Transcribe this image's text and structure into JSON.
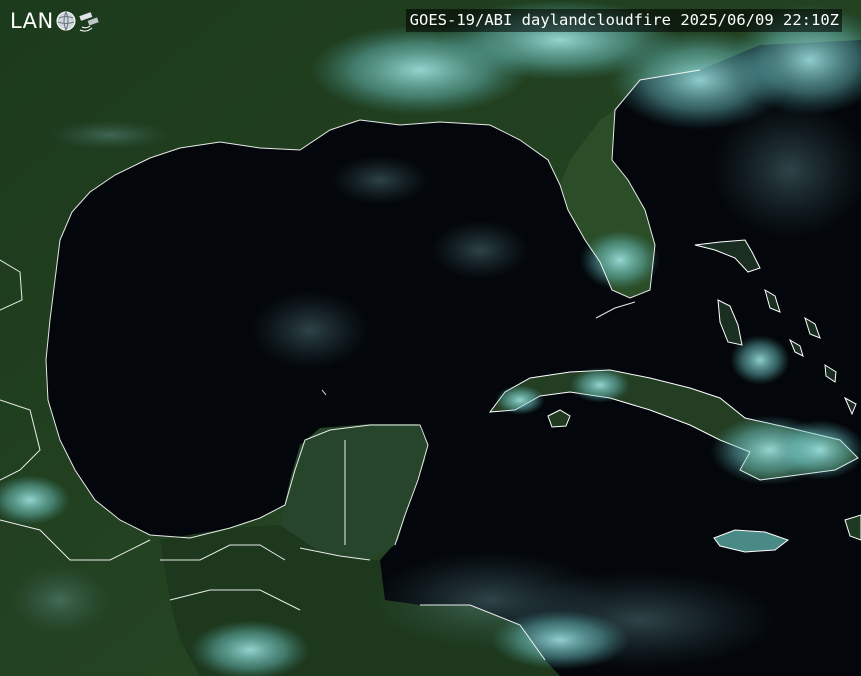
{
  "logo": {
    "text": "LAN",
    "icon": "globe-satellite-icon"
  },
  "banner": {
    "satellite": "GOES-19/ABI",
    "product": "daylandcloudfire",
    "date": "2025/06/09",
    "time": "22:10Z"
  },
  "colors": {
    "ocean": "#03060a",
    "land": "#1f3a1c",
    "land_dark": "#15291a",
    "cloud": "#8ee0e0",
    "coastline": "#ffffff"
  }
}
